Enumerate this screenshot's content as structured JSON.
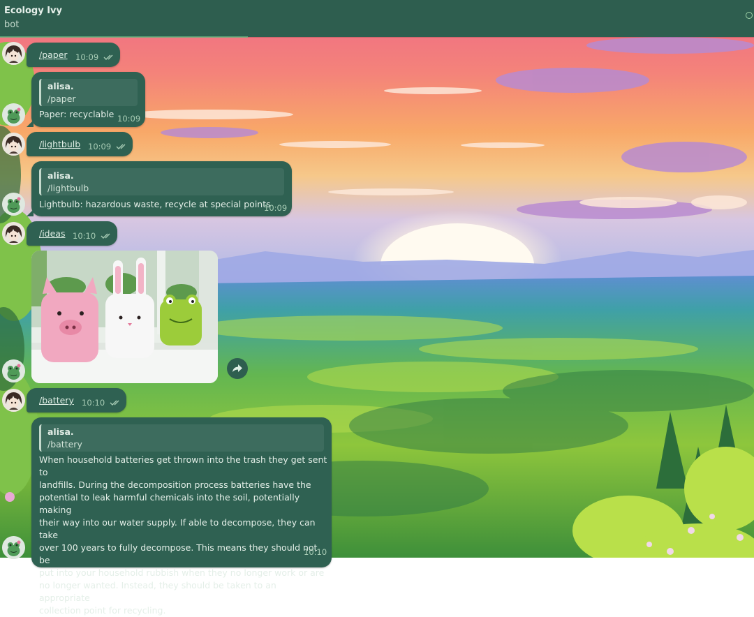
{
  "header": {
    "title": "Ecology Ivy",
    "subtitle": "bot"
  },
  "colors": {
    "header_bg": "#2e5e4f",
    "bubble_bg": "#2f6152",
    "time_text": "#a9cdb6"
  },
  "messages": [
    {
      "sender": "user",
      "text": "/paper",
      "time": "10:09",
      "status": "read"
    },
    {
      "sender": "bot",
      "reply_name": "alisa.",
      "reply_text": "/paper",
      "text": "Paper: recyclable",
      "time": "10:09"
    },
    {
      "sender": "user",
      "text": "/lightbulb",
      "time": "10:09",
      "status": "read"
    },
    {
      "sender": "bot",
      "reply_name": "alisa.",
      "reply_text": "/lightbulb",
      "text": "Lightbulb: hazardous waste, recycle at special points",
      "time": "10:09"
    },
    {
      "sender": "user",
      "text": "/ideas",
      "time": "10:10",
      "status": "read"
    },
    {
      "sender": "bot",
      "type": "photo",
      "photo_subject": "recycled plastic bottle planters shaped as a pig, a bunny and a frog with succulents"
    },
    {
      "sender": "user",
      "text": "/battery",
      "time": "10:10",
      "status": "read"
    },
    {
      "sender": "bot",
      "reply_name": "alisa.",
      "reply_text": "/battery",
      "time": "10:10",
      "lines": [
        "When household batteries get thrown into the trash they get sent to",
        "landfills. During the decomposition process batteries have the",
        "potential to leak harmful chemicals into the soil, potentially making",
        "their way into our water supply. If able to decompose, they can take",
        "over 100 years to fully decompose. This means they should not be",
        "put into your household rubbish when they no longer work or are",
        "no longer wanted. Instead, they should be taken to an appropriate",
        "collection point for recycling."
      ]
    }
  ]
}
